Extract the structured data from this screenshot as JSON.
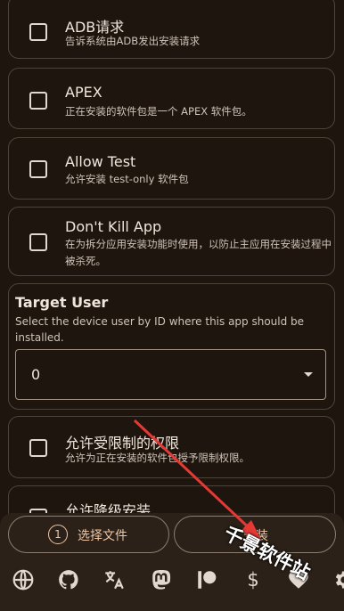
{
  "options": [
    {
      "title": "ADB请求",
      "desc": "告诉系统由ADB发出安装请求"
    },
    {
      "title": "APEX",
      "desc": "正在安装的软件包是一个 APEX 软件包。"
    },
    {
      "title": "Allow Test",
      "desc": "允许安装 test-only 软件包"
    },
    {
      "title": "Don't Kill App",
      "desc": "在为拆分应用安装功能时使用，以防止主应用在安装过程中被杀死。"
    }
  ],
  "target_user": {
    "title": "Target User",
    "desc": "Select the device user by ID where this app should be installed.",
    "value": "0"
  },
  "options2": [
    {
      "title": "允许受限制的权限",
      "desc": "允许为正在安装的软件包授予限制权限。"
    },
    {
      "title": "允许降级安装"
    }
  ],
  "actions": {
    "pick_count": "1",
    "pick_label": "选择文件",
    "install_label": "安装"
  },
  "icons": [
    "globe-icon",
    "github-icon",
    "translate-icon",
    "mastodon-icon",
    "patreon-icon",
    "dollar-icon",
    "heart-icon",
    "gear-icon"
  ],
  "dollar_glyph": "$",
  "watermark": "千景软件站",
  "colors": {
    "background": "#1e150e",
    "accent": "#efc7a4",
    "annotation_arrow": "#e53935"
  }
}
